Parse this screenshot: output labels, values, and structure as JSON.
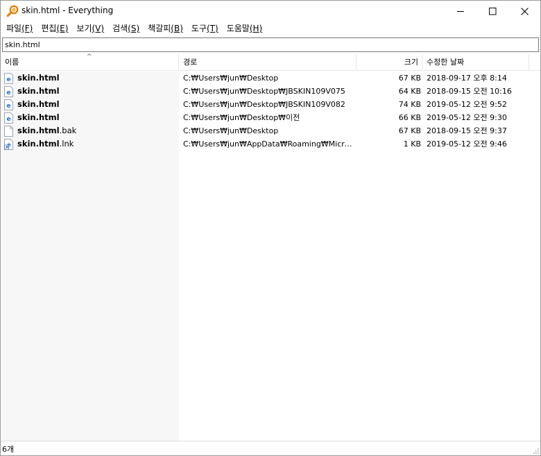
{
  "window": {
    "title": "skin.html - Everything",
    "accent": "#e87d0d"
  },
  "menu": [
    {
      "label": "파일",
      "key": "(F)"
    },
    {
      "label": "편집",
      "key": "(E)"
    },
    {
      "label": "보기",
      "key": "(V)"
    },
    {
      "label": "검색",
      "key": "(S)"
    },
    {
      "label": "책갈피",
      "key": "(B)"
    },
    {
      "label": "도구",
      "key": "(T)"
    },
    {
      "label": "도움말",
      "key": "(H)"
    }
  ],
  "search": {
    "value": "skin.html"
  },
  "columns": {
    "name": "이름",
    "path": "경로",
    "size": "크기",
    "date": "수정한 날짜",
    "sort_indicator": "^"
  },
  "rows": [
    {
      "match": "skin.html",
      "rest": "",
      "icon": "html-file-icon",
      "path": "C:₩Users₩jun₩Desktop",
      "size": "67 KB",
      "date": "2018-09-17 오후 8:14"
    },
    {
      "match": "skin.html",
      "rest": "",
      "icon": "html-file-icon",
      "path": "C:₩Users₩jun₩Desktop₩JBSKIN109V075",
      "size": "64 KB",
      "date": "2018-09-15 오전 10:16"
    },
    {
      "match": "skin.html",
      "rest": "",
      "icon": "html-file-icon",
      "path": "C:₩Users₩jun₩Desktop₩JBSKIN109V082",
      "size": "74 KB",
      "date": "2019-05-12 오전 9:52"
    },
    {
      "match": "skin.html",
      "rest": "",
      "icon": "html-file-icon",
      "path": "C:₩Users₩jun₩Desktop₩이전",
      "size": "66 KB",
      "date": "2019-05-12 오전 9:30"
    },
    {
      "match": "skin.html",
      "rest": ".bak",
      "icon": "blank-file-icon",
      "path": "C:₩Users₩jun₩Desktop",
      "size": "67 KB",
      "date": "2018-09-15 오전 9:37"
    },
    {
      "match": "skin.html",
      "rest": ".lnk",
      "icon": "shortcut-file-icon",
      "path": "C:₩Users₩jun₩AppData₩Roaming₩Microso...",
      "size": "1 KB",
      "date": "2019-05-12 오전 9:46"
    }
  ],
  "status": {
    "count": "6개"
  }
}
